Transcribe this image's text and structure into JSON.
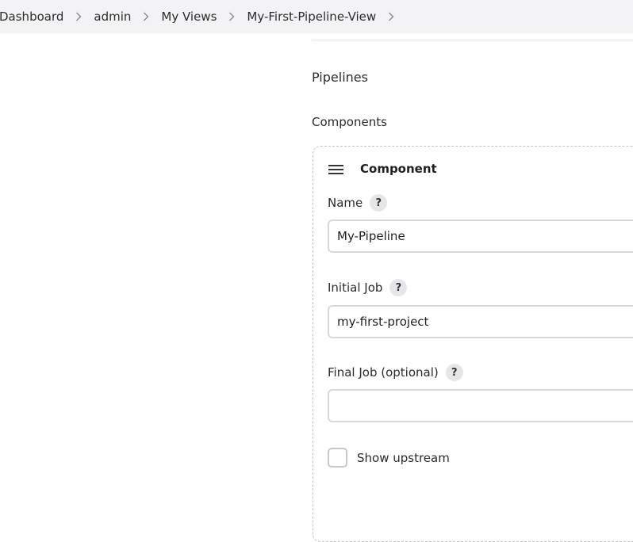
{
  "breadcrumb": {
    "items": [
      "Dashboard",
      "admin",
      "My Views",
      "My-First-Pipeline-View"
    ]
  },
  "section": {
    "title": "Pipelines",
    "components_label": "Components"
  },
  "component": {
    "title": "Component",
    "fields": {
      "name": {
        "label": "Name",
        "value": "My-Pipeline"
      },
      "initial_job": {
        "label": "Initial Job",
        "value": "my-first-project"
      },
      "final_job": {
        "label": "Final Job (optional)",
        "value": ""
      }
    },
    "show_upstream": {
      "label": "Show upstream",
      "checked": false
    }
  },
  "icons": {
    "drag": "drag-handle-icon",
    "help": "help-icon",
    "chevron": "chevron-right-icon"
  },
  "colors": {
    "breadcrumb_bg": "#f3f3f5",
    "border": "#d8d8dc",
    "help_bg": "#e6e6e8"
  }
}
